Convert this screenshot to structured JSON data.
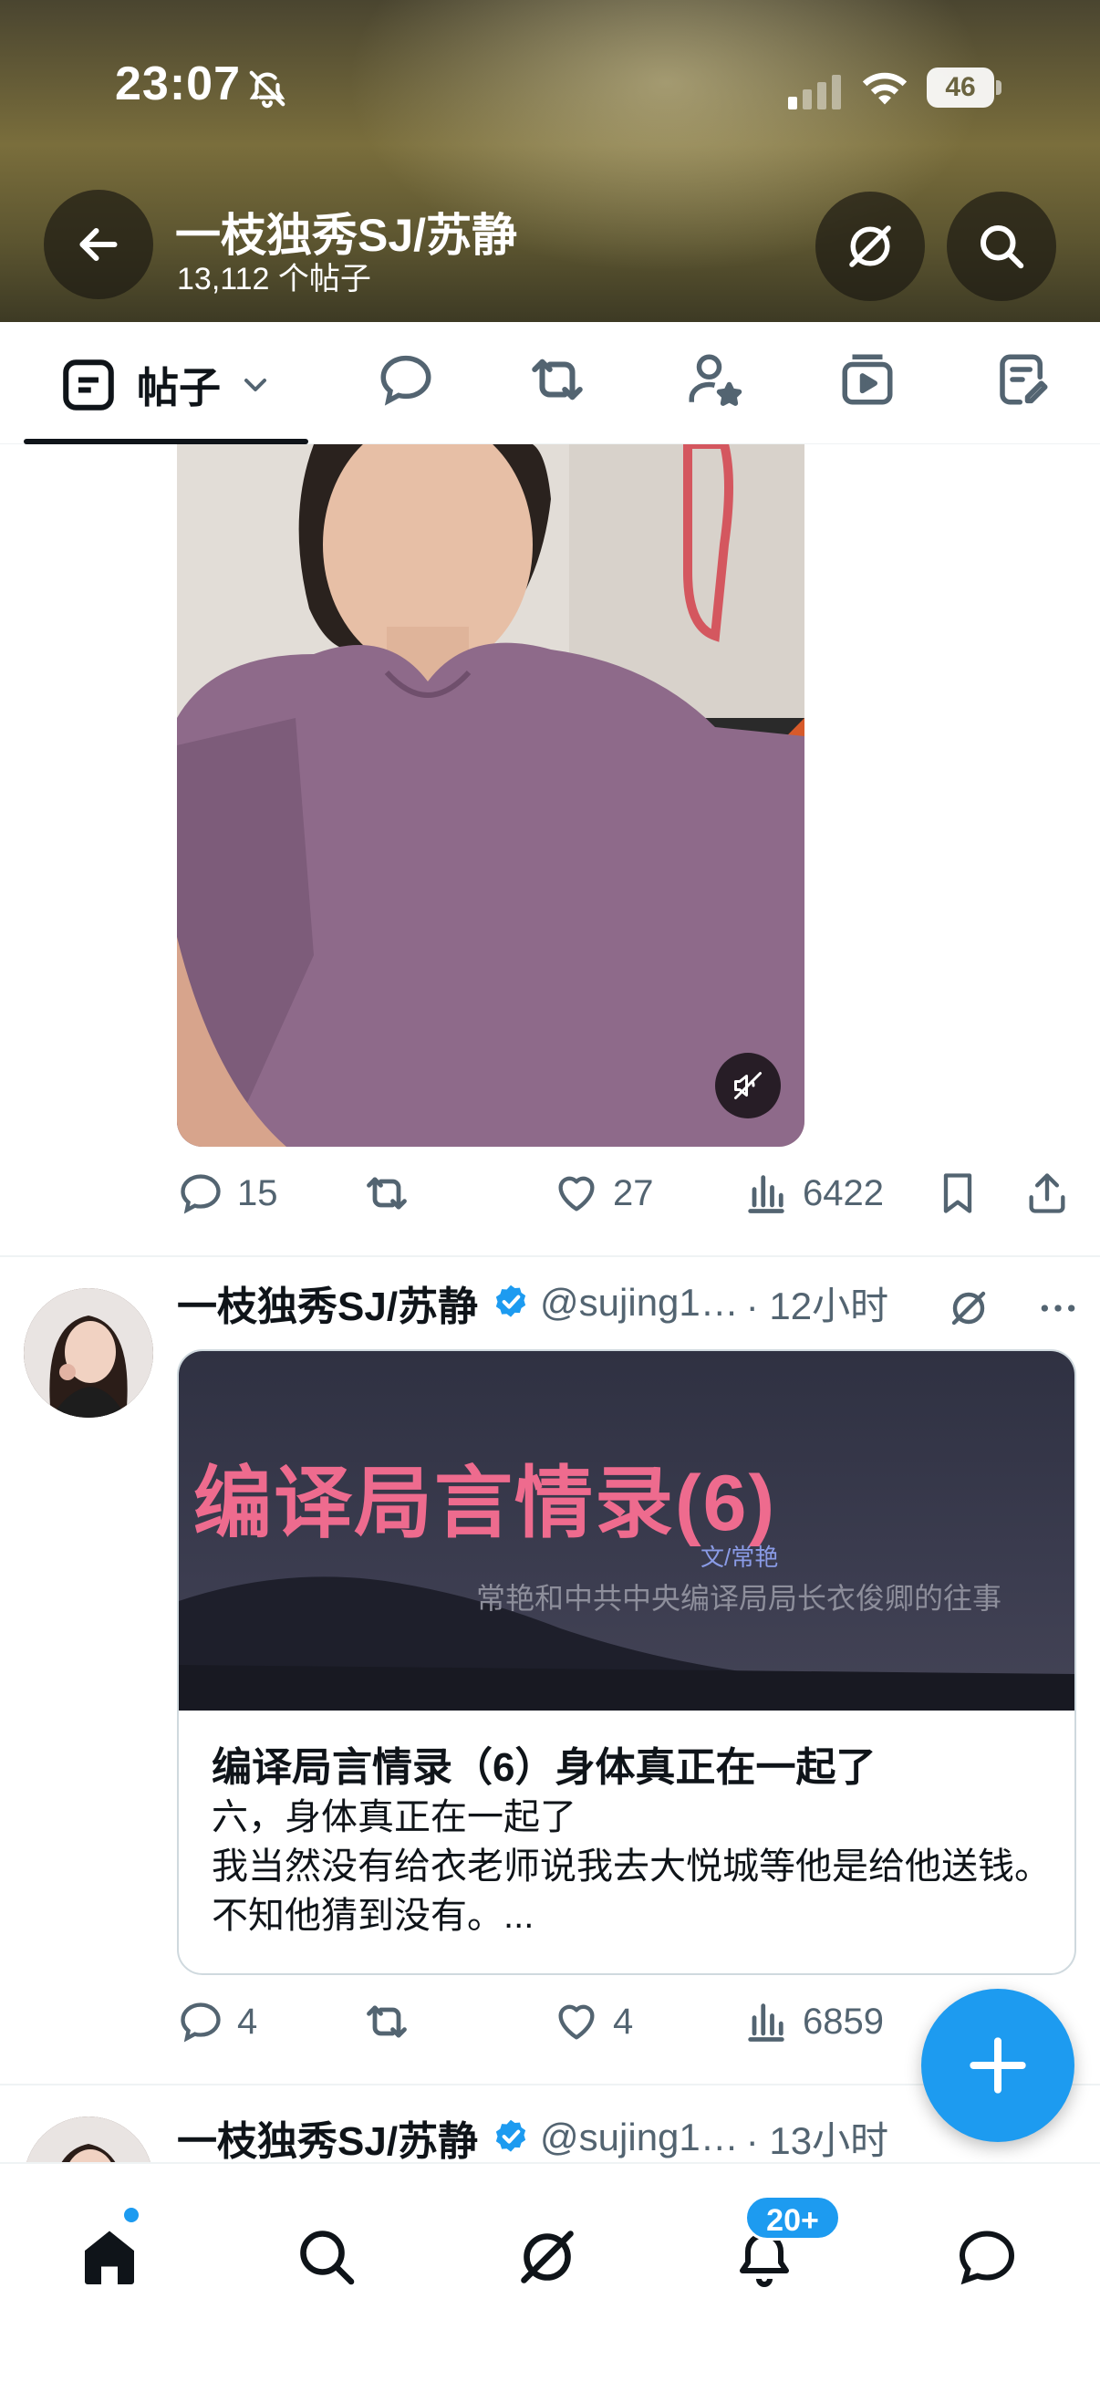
{
  "status_bar": {
    "time": "23:07",
    "battery": "46"
  },
  "profile": {
    "name": "一枝独秀SJ/苏静",
    "post_count": "13,112 个帖子"
  },
  "tabs": [
    {
      "label": "帖子",
      "icon": "posts-icon",
      "selected": true
    },
    {
      "icon": "replies-icon"
    },
    {
      "icon": "reposts-icon"
    },
    {
      "icon": "highlights-icon"
    },
    {
      "icon": "media-icon"
    },
    {
      "icon": "articles-icon"
    }
  ],
  "posts": [
    {
      "media": "video",
      "stats": {
        "replies": "15",
        "reposts": "",
        "likes": "27",
        "views": "6422"
      }
    },
    {
      "author": "一枝独秀SJ/苏静",
      "handle": "@sujing1…",
      "time": "· 12小时",
      "card": {
        "image_title": "编译局言情录(6)",
        "image_byline": "文/常艳",
        "image_subtitle": "常艳和中共中央编译局局长衣俊卿的往事",
        "title": "编译局言情录（6）身体真正在一起了",
        "description": "六，身体真正在一起了\n我当然没有给衣老师说我去大悦城等他是给他送钱。不知他猜到没有。..."
      },
      "stats": {
        "replies": "4",
        "reposts": "",
        "likes": "4",
        "views": "6859"
      }
    },
    {
      "author": "一枝独秀SJ/苏静",
      "handle": "@sujing1…",
      "time": "· 13小时"
    }
  ],
  "bottom_nav": {
    "notifications_badge": "20+"
  },
  "colors": {
    "accent": "#1d9bf0",
    "text": "#0f1419",
    "muted": "#536471"
  }
}
